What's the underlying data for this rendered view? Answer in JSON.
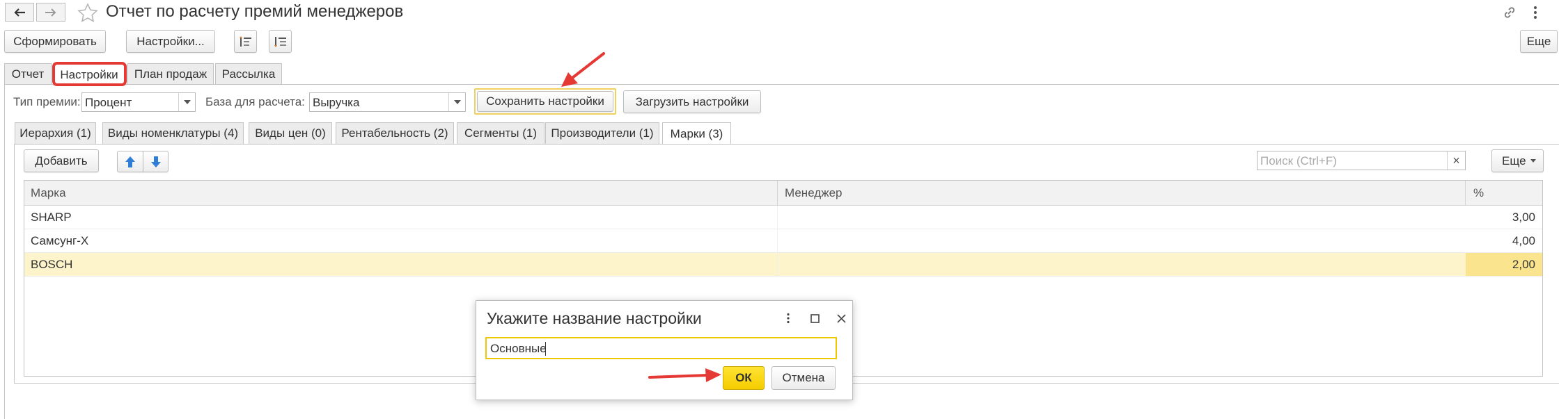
{
  "window": {
    "title": "Отчет по расчету премий менеджеров",
    "icons": [
      "back-arrow-icon",
      "forward-arrow-icon",
      "star-icon",
      "link-icon",
      "more-vertical-icon"
    ]
  },
  "toolbar": {
    "generate_label": "Сформировать",
    "settings_label": "Настройки...",
    "more_label": "Еще",
    "icons": [
      "group-expand-icon",
      "group-collapse-icon"
    ]
  },
  "tabs": [
    {
      "label": "Отчет",
      "active": false
    },
    {
      "label": "Настройки",
      "active": true
    },
    {
      "label": "План продаж",
      "active": false
    },
    {
      "label": "Рассылка",
      "active": false
    }
  ],
  "settings": {
    "bonus_type_label": "Тип премии:",
    "bonus_type_value": "Процент",
    "base_label": "База для расчета:",
    "base_value": "Выручка",
    "save_label": "Сохранить настройки",
    "load_label": "Загрузить настройки"
  },
  "inner_tabs": [
    {
      "label": "Иерархия (1)",
      "active": false
    },
    {
      "label": "Виды номенклатуры (4)",
      "active": false
    },
    {
      "label": "Виды цен (0)",
      "active": false
    },
    {
      "label": "Рентабельность (2)",
      "active": false
    },
    {
      "label": "Сегменты (1)",
      "active": false
    },
    {
      "label": "Производители (1)",
      "active": false
    },
    {
      "label": "Марки (3)",
      "active": true
    }
  ],
  "inner_toolbar": {
    "add_label": "Добавить",
    "search_placeholder": "Поиск (Ctrl+F)",
    "clear_label": "×",
    "more_label": "Еще"
  },
  "table": {
    "columns": [
      "Марка",
      "Менеджер",
      "%"
    ],
    "rows": [
      {
        "brand": "SHARP",
        "manager": "",
        "percent": "3,00",
        "selected": false
      },
      {
        "brand": "Самсунг-X",
        "manager": "",
        "percent": "4,00",
        "selected": false
      },
      {
        "brand": "BOSCH",
        "manager": "",
        "percent": "2,00",
        "selected": true
      }
    ]
  },
  "dialog": {
    "title": "Укажите название настройки",
    "input_value": "Основные",
    "ok_label": "ОК",
    "cancel_label": "Отмена"
  },
  "colors": {
    "accent_yellow": "#f5cc00",
    "annotation_red": "#e53935",
    "selected_row": "#fdf4cc",
    "selected_cell": "#fbe48e"
  }
}
